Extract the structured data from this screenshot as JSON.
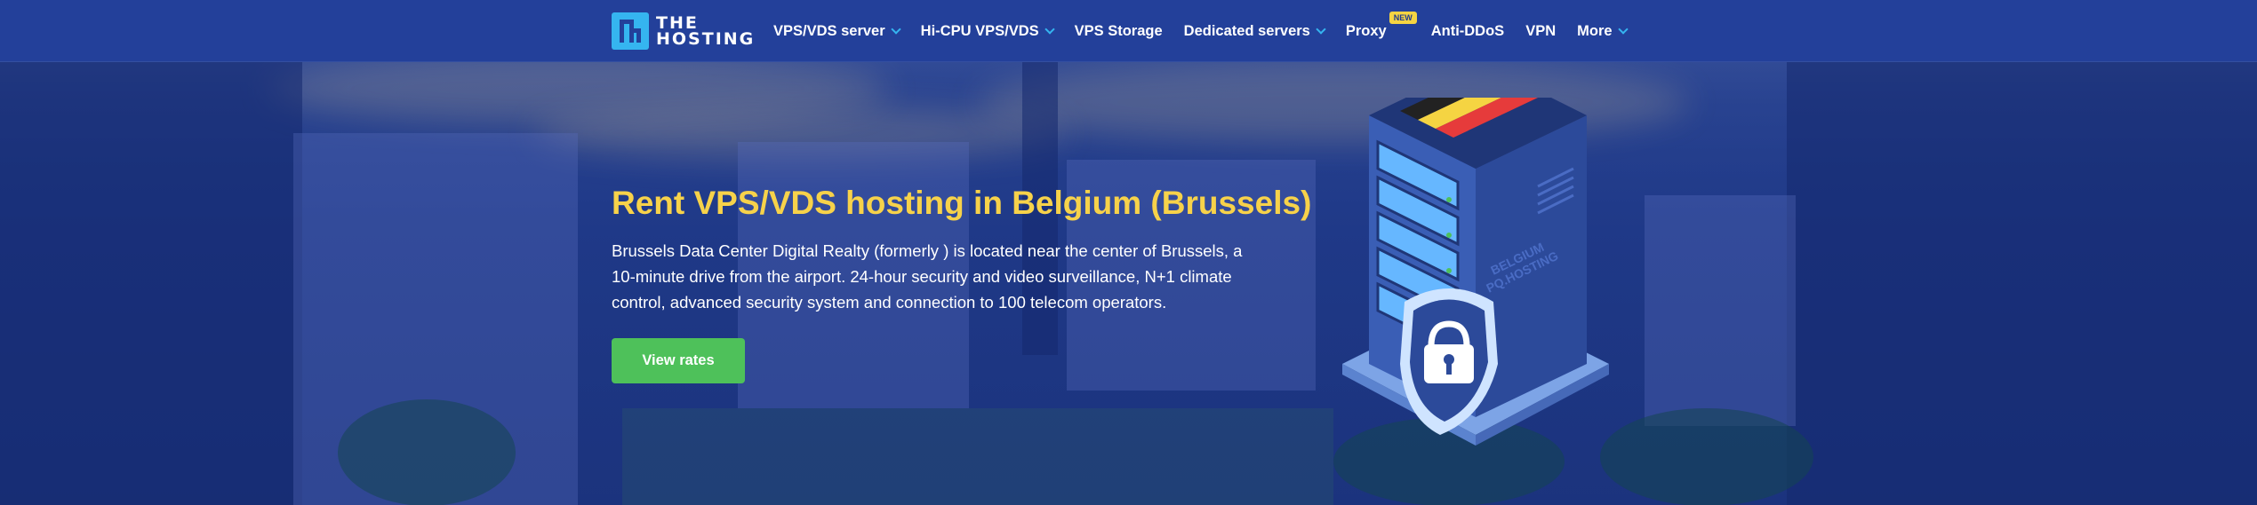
{
  "header": {
    "logo_text_line1": "THE",
    "logo_text_line2": "HOSTING",
    "nav": [
      {
        "label": "VPS/VDS server",
        "dropdown": true
      },
      {
        "label": "Hi-CPU VPS/VDS",
        "dropdown": true
      },
      {
        "label": "VPS Storage",
        "dropdown": false
      },
      {
        "label": "Dedicated servers",
        "dropdown": true
      },
      {
        "label": "Proxy",
        "dropdown": false,
        "badge": "NEW"
      },
      {
        "label": "Anti-DDoS",
        "dropdown": false
      },
      {
        "label": "VPN",
        "dropdown": false
      },
      {
        "label": "More",
        "dropdown": true
      }
    ]
  },
  "hero": {
    "title": "Rent VPS/VDS hosting in Belgium (Brussels)",
    "description": "Brussels Data Center Digital Realty (formerly ) is located near the center of Brussels, a 10-minute drive from the airport. 24-hour security and video surveillance, N+1 climate control, advanced security system and connection to 100 telecom operators.",
    "cta_label": "View rates",
    "illustration_text_line1": "BELGIUM",
    "illustration_text_line2": "PQ.HOSTING"
  },
  "colors": {
    "header_bg": "#23409a",
    "title": "#f7d24a",
    "cta": "#4ec15a",
    "accent": "#35b5f0"
  }
}
